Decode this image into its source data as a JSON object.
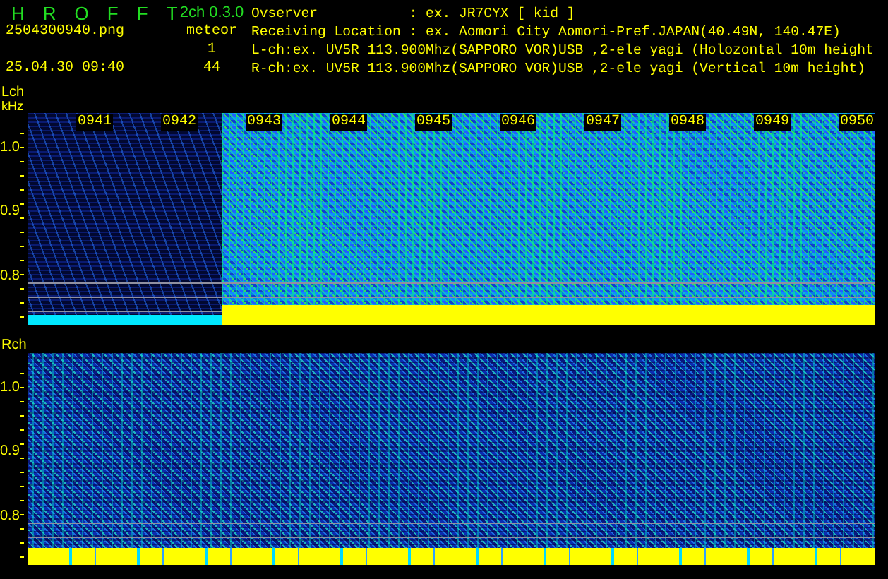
{
  "header": {
    "title_letters": [
      "H",
      "R",
      "O",
      "F",
      "F",
      "T"
    ],
    "version": "2ch 0.3.0",
    "filename": "2504300940.png",
    "datetime": "25.04.30 09:40",
    "meteor_label": "meteor",
    "meteor_counts": [
      "1",
      "44"
    ],
    "info_lines": [
      "Ovserver           : ex. JR7CYX [ kid ]",
      "Receiving Location : ex. Aomori City Aomori-Pref.JAPAN(40.49N, 140.47E)",
      "L-ch:ex. UV5R 113.900Mhz(SAPPORO VOR)USB ,2-ele yagi (Holozontal 10m height",
      "R-ch:ex. UV5R 113.900Mhz(SAPPORO VOR)USB ,2-ele yagi (Vertical 10m height)"
    ]
  },
  "panels": [
    {
      "kind": "left",
      "label": "Lch",
      "unit": "kHz",
      "yticks": [
        "1.0",
        "0.9",
        "0.8"
      ],
      "times": [
        "0941",
        "0942",
        "0943",
        "0944",
        "0945",
        "0946",
        "0947",
        "0948",
        "0949",
        "0950"
      ]
    },
    {
      "kind": "right",
      "label": "Rch",
      "yticks": [
        "1.0",
        "0.9",
        "0.8"
      ]
    }
  ]
}
